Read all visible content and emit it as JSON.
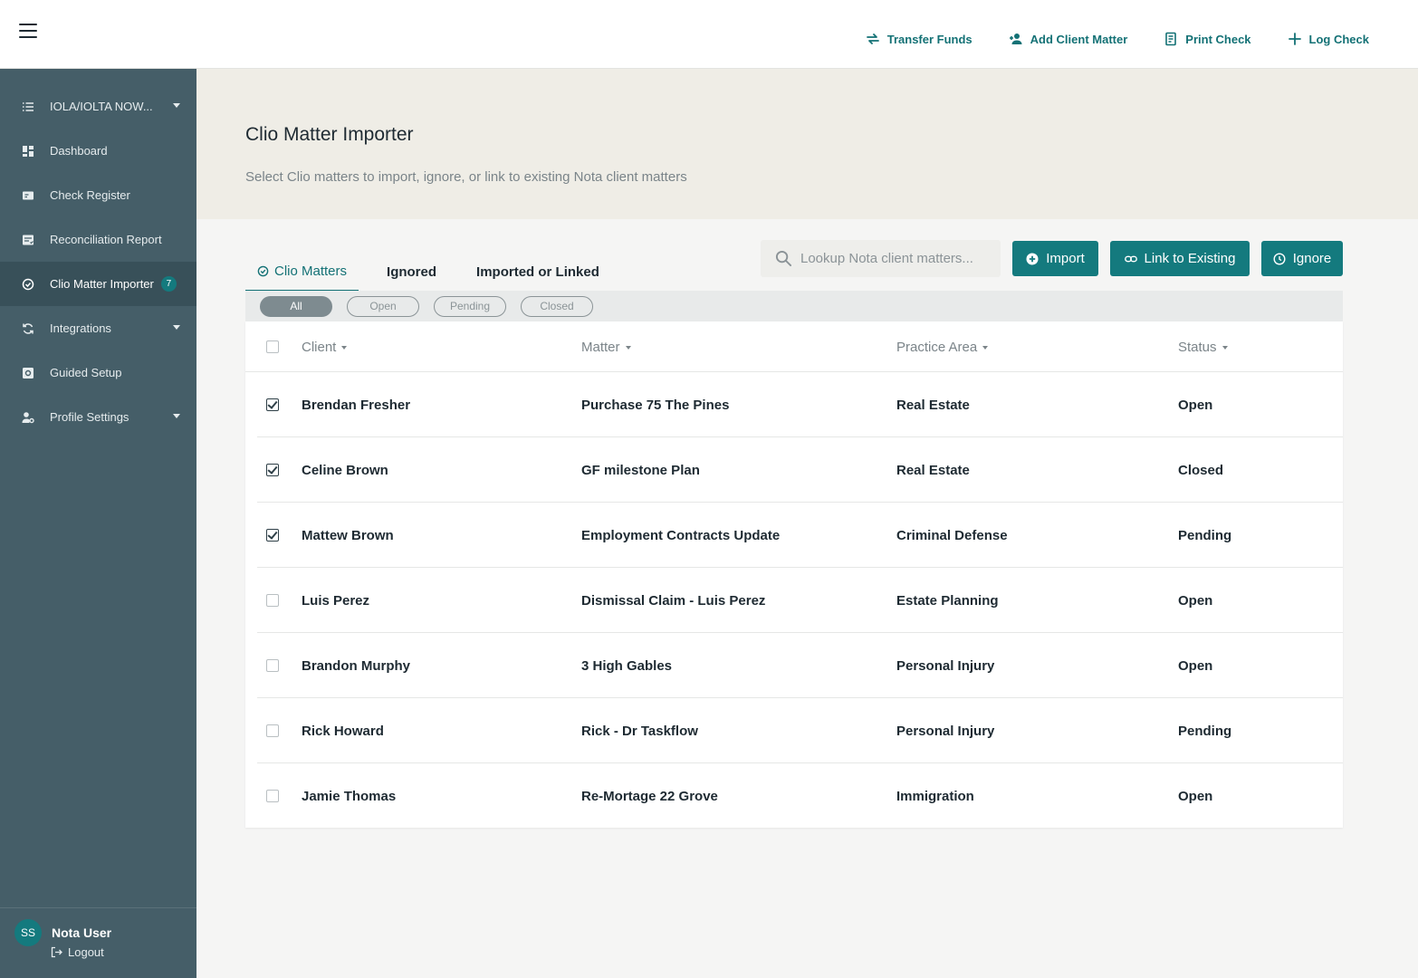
{
  "topbar": {
    "actions": [
      {
        "label": "Transfer Funds",
        "icon": "transfer-icon"
      },
      {
        "label": "Add Client Matter",
        "icon": "add-user-icon"
      },
      {
        "label": "Print Check",
        "icon": "print-icon"
      },
      {
        "label": "Log Check",
        "icon": "plus-icon"
      }
    ]
  },
  "sidebar": {
    "items": [
      {
        "label": "IOLA/IOLTA NOW...",
        "icon": "list-icon"
      },
      {
        "label": "Dashboard",
        "icon": "dashboard-icon"
      },
      {
        "label": "Check Register",
        "icon": "check-register-icon"
      },
      {
        "label": "Reconciliation Report",
        "icon": "report-icon"
      },
      {
        "label": "Clio Matter Importer",
        "icon": "check-circle-icon",
        "badge": "7"
      },
      {
        "label": "Integrations",
        "icon": "sync-icon"
      },
      {
        "label": "Guided Setup",
        "icon": "setup-icon"
      },
      {
        "label": "Profile Settings",
        "icon": "user-settings-icon"
      }
    ],
    "user": {
      "initials": "SS",
      "name": "Nota User",
      "logout": "Logout"
    }
  },
  "header": {
    "title": "Clio Matter Importer",
    "subtitle": "Select Clio matters to import, ignore, or link to existing Nota client matters"
  },
  "tabs": [
    "Clio Matters",
    "Ignored",
    "Imported or Linked"
  ],
  "search": {
    "placeholder": "Lookup Nota client matters..."
  },
  "buttons": {
    "import": "Import",
    "link": "Link to Existing",
    "ignore": "Ignore"
  },
  "filters": [
    "All",
    "Open",
    "Pending",
    "Closed"
  ],
  "table": {
    "columns": [
      "Client",
      "Matter",
      "Practice Area",
      "Status"
    ],
    "rows": [
      {
        "checked": true,
        "client": "Brendan Fresher",
        "matter": "Purchase 75 The Pines",
        "area": "Real Estate",
        "status": "Open"
      },
      {
        "checked": true,
        "client": "Celine Brown",
        "matter": "GF milestone Plan",
        "area": "Real Estate",
        "status": "Closed"
      },
      {
        "checked": true,
        "client": "Mattew Brown",
        "matter": "Employment Contracts Update",
        "area": "Criminal Defense",
        "status": "Pending"
      },
      {
        "checked": false,
        "client": "Luis Perez",
        "matter": "Dismissal Claim - Luis Perez",
        "area": "Estate Planning",
        "status": "Open"
      },
      {
        "checked": false,
        "client": "Brandon Murphy",
        "matter": "3 High Gables",
        "area": "Personal Injury",
        "status": "Open"
      },
      {
        "checked": false,
        "client": "Rick Howard",
        "matter": "Rick - Dr Taskflow",
        "area": "Personal Injury",
        "status": "Pending"
      },
      {
        "checked": false,
        "client": "Jamie Thomas",
        "matter": "Re-Mortage 22 Grove",
        "area": "Immigration",
        "status": "Open"
      }
    ]
  },
  "colors": {
    "accent": "#147a7e",
    "sidebar": "#455e68",
    "header_bg": "#efede6"
  }
}
